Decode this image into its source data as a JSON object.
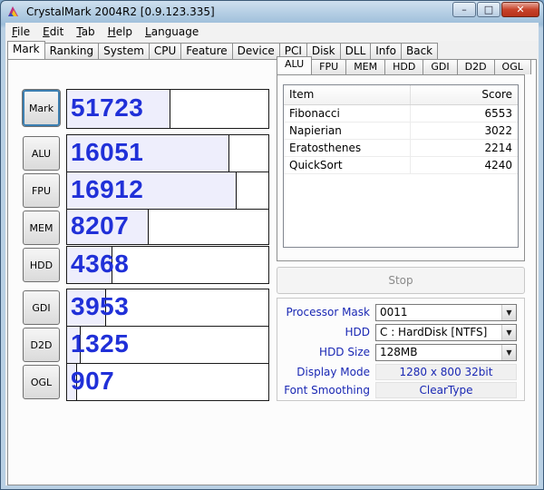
{
  "window": {
    "title": "CrystalMark 2004R2 [0.9.123.335]",
    "buttons": {
      "minimize": "–",
      "maximize": "□",
      "close": "✕"
    }
  },
  "menu": [
    {
      "underline": "F",
      "rest": "ile"
    },
    {
      "underline": "E",
      "rest": "dit"
    },
    {
      "underline": "T",
      "rest": "ab"
    },
    {
      "underline": "H",
      "rest": "elp"
    },
    {
      "underline": "L",
      "rest": "anguage"
    }
  ],
  "tabs": [
    "Mark",
    "Ranking",
    "System",
    "CPU",
    "Feature",
    "Device",
    "PCI",
    "Disk",
    "DLL",
    "Info",
    "Back"
  ],
  "active_tab": "Mark",
  "marks": {
    "mark": {
      "label": "Mark",
      "score": "51723",
      "fill": 0.51
    },
    "alu": {
      "label": "ALU",
      "score": "16051",
      "fill": 0.8
    },
    "fpu": {
      "label": "FPU",
      "score": "16912",
      "fill": 0.84
    },
    "mem": {
      "label": "MEM",
      "score": "8207",
      "fill": 0.4
    },
    "hdd": {
      "label": "HDD",
      "score": "4368",
      "fill": 0.22
    },
    "gdi": {
      "label": "GDI",
      "score": "3953",
      "fill": 0.19
    },
    "d2d": {
      "label": "D2D",
      "score": "1325",
      "fill": 0.065
    },
    "ogl": {
      "label": "OGL",
      "score": "907",
      "fill": 0.045
    }
  },
  "sub_tabs": [
    "ALU",
    "FPU",
    "MEM",
    "HDD",
    "GDI",
    "D2D",
    "OGL"
  ],
  "active_sub_tab": "ALU",
  "results": {
    "headers": {
      "item": "Item",
      "score": "Score"
    },
    "rows": [
      {
        "item": "Fibonacci",
        "score": "6553"
      },
      {
        "item": "Napierian",
        "score": "3022"
      },
      {
        "item": "Eratosthenes",
        "score": "2214"
      },
      {
        "item": "QuickSort",
        "score": "4240"
      }
    ]
  },
  "stop_label": "Stop",
  "settings": {
    "processor_mask": {
      "label": "Processor Mask",
      "value": "0011"
    },
    "hdd": {
      "label": "HDD",
      "value": "C : HardDisk [NTFS]"
    },
    "hdd_size": {
      "label": "HDD Size",
      "value": "128MB"
    },
    "display_mode": {
      "label": "Display Mode",
      "value": "1280 x 800 32bit"
    },
    "font_smoothing": {
      "label": "Font Smoothing",
      "value": "ClearType"
    }
  }
}
